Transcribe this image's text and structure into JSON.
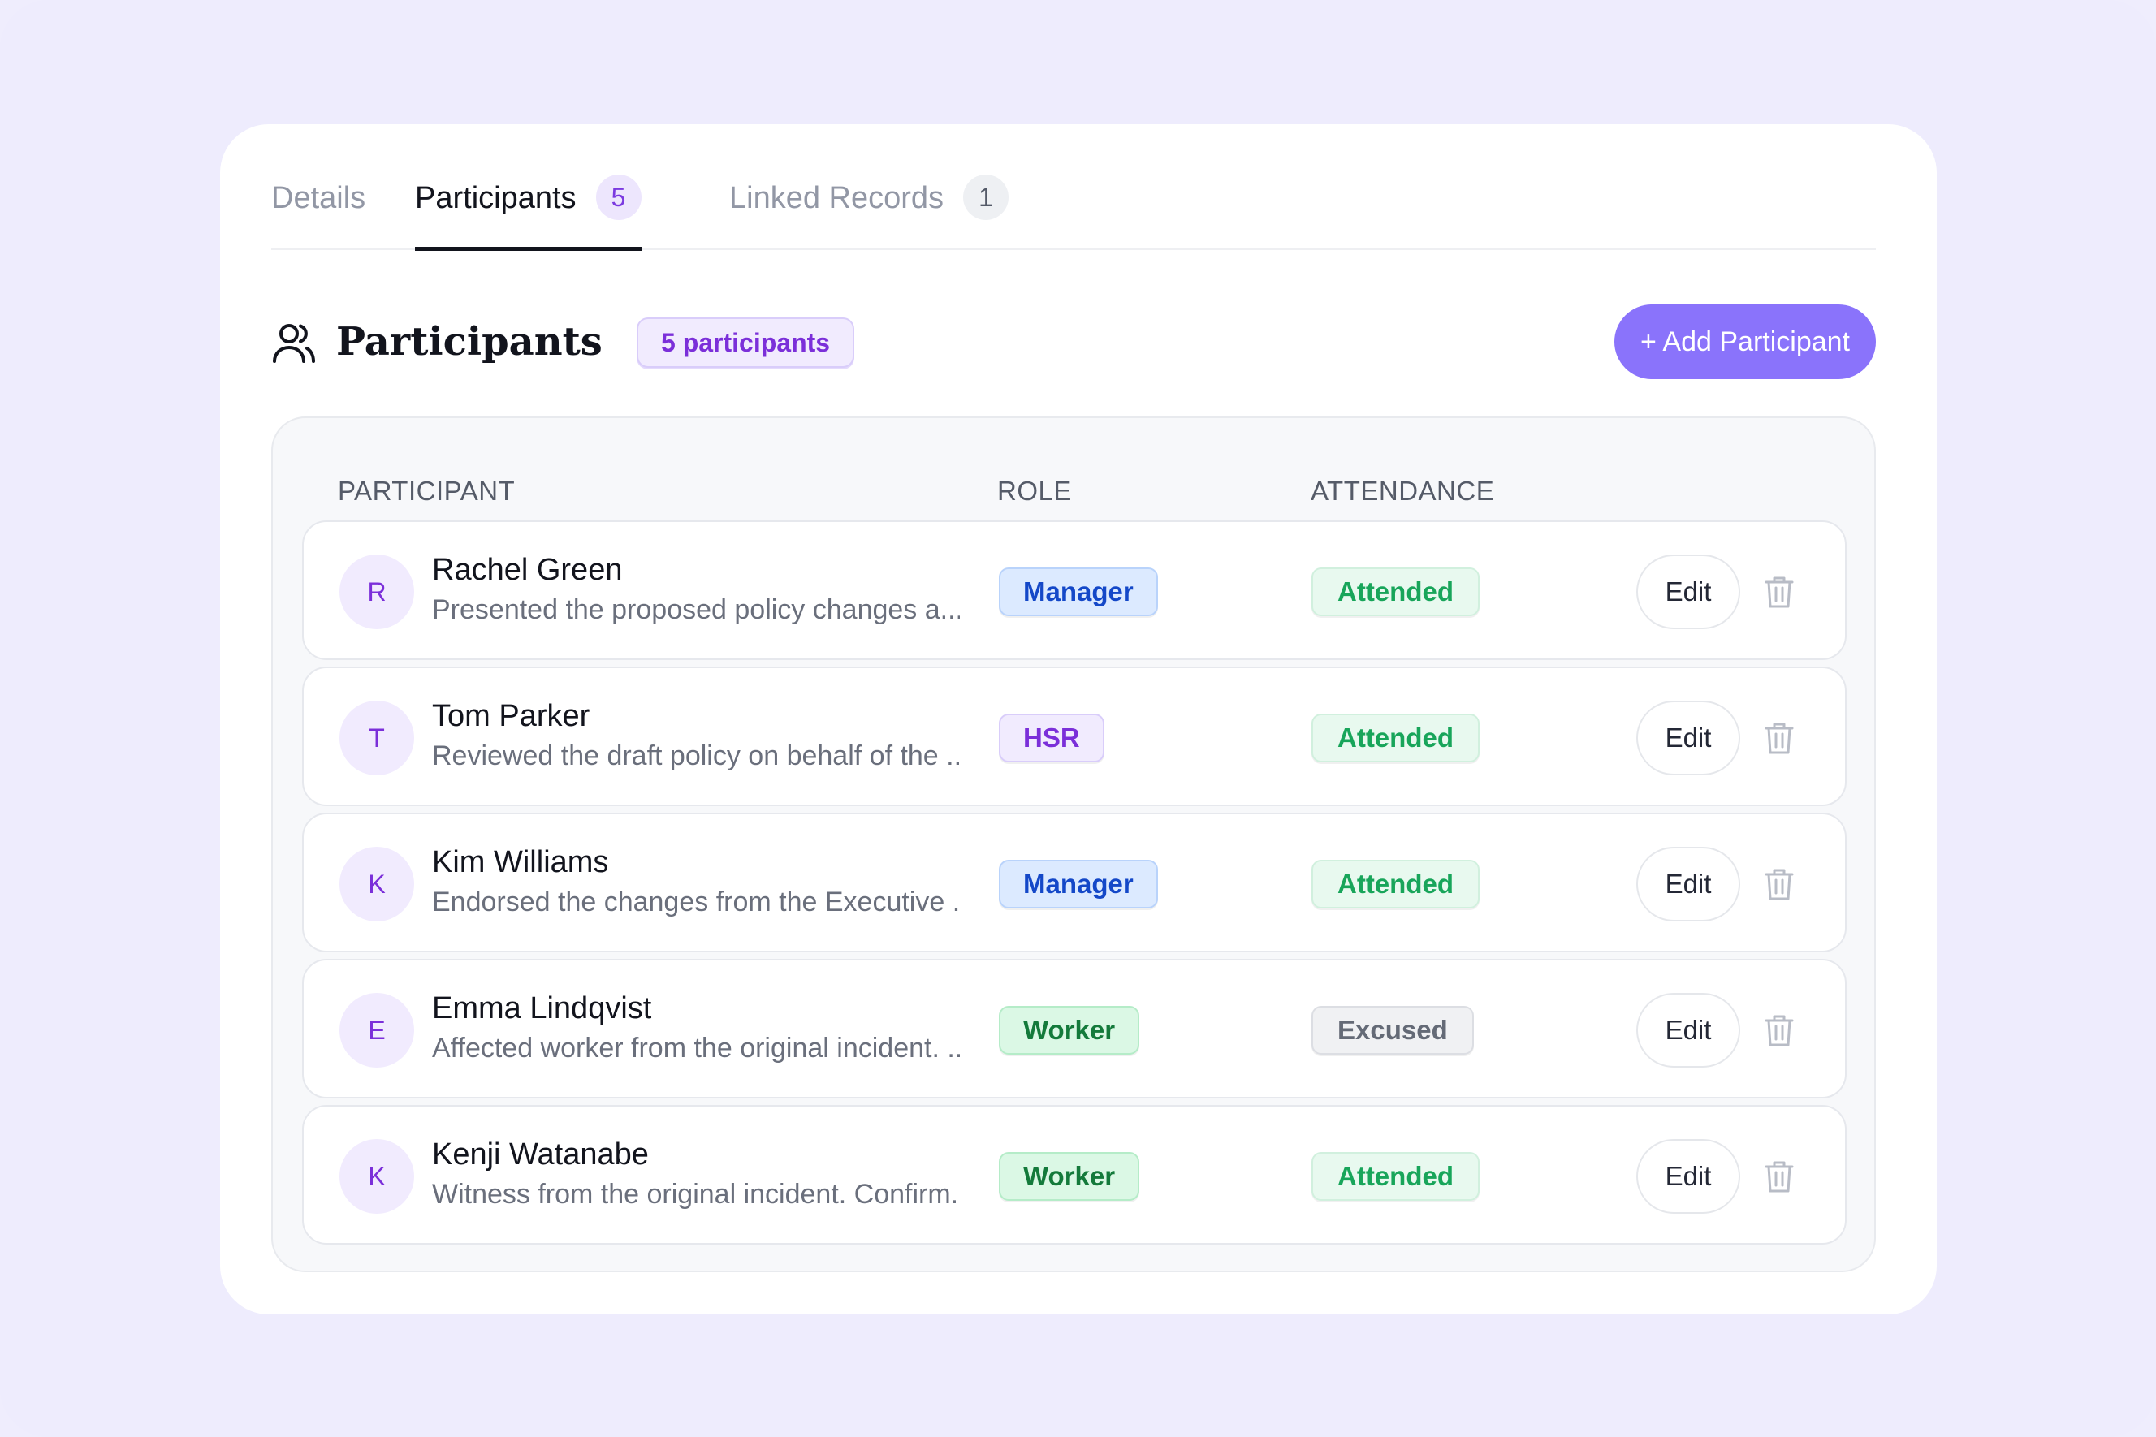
{
  "tabs": [
    {
      "label": "Details",
      "badge": null
    },
    {
      "label": "Participants",
      "badge": "5"
    },
    {
      "label": "Linked Records",
      "badge": "1"
    }
  ],
  "section": {
    "title": "Participants",
    "count_label": "5 participants",
    "add_button": "+ Add Participant",
    "icon": "users-icon"
  },
  "table": {
    "headers": {
      "participant": "PARTICIPANT",
      "role": "ROLE",
      "attendance": "ATTENDANCE"
    },
    "edit_label": "Edit",
    "rows": [
      {
        "initial": "R",
        "name": "Rachel Green",
        "note": "Presented the proposed policy changes a...",
        "role": "Manager",
        "attendance": "Attended"
      },
      {
        "initial": "T",
        "name": "Tom Parker",
        "note": "Reviewed the draft policy on behalf of the ...",
        "role": "HSR",
        "attendance": "Attended"
      },
      {
        "initial": "K",
        "name": "Kim Williams",
        "note": "Endorsed the changes from the Executive ...",
        "role": "Manager",
        "attendance": "Attended"
      },
      {
        "initial": "E",
        "name": "Emma Lindqvist",
        "note": "Affected worker from the original incident. ...",
        "role": "Worker",
        "attendance": "Excused"
      },
      {
        "initial": "K",
        "name": "Kenji Watanabe",
        "note": "Witness from the original incident. Confirm...",
        "role": "Worker",
        "attendance": "Attended"
      }
    ]
  },
  "colors": {
    "accent": "#8a73fb",
    "background": "#eeecfd",
    "manager": "#1448c8",
    "hsr": "#7b2fd9",
    "worker": "#147a3b",
    "attended": "#18a55a",
    "excused": "#646a76"
  }
}
